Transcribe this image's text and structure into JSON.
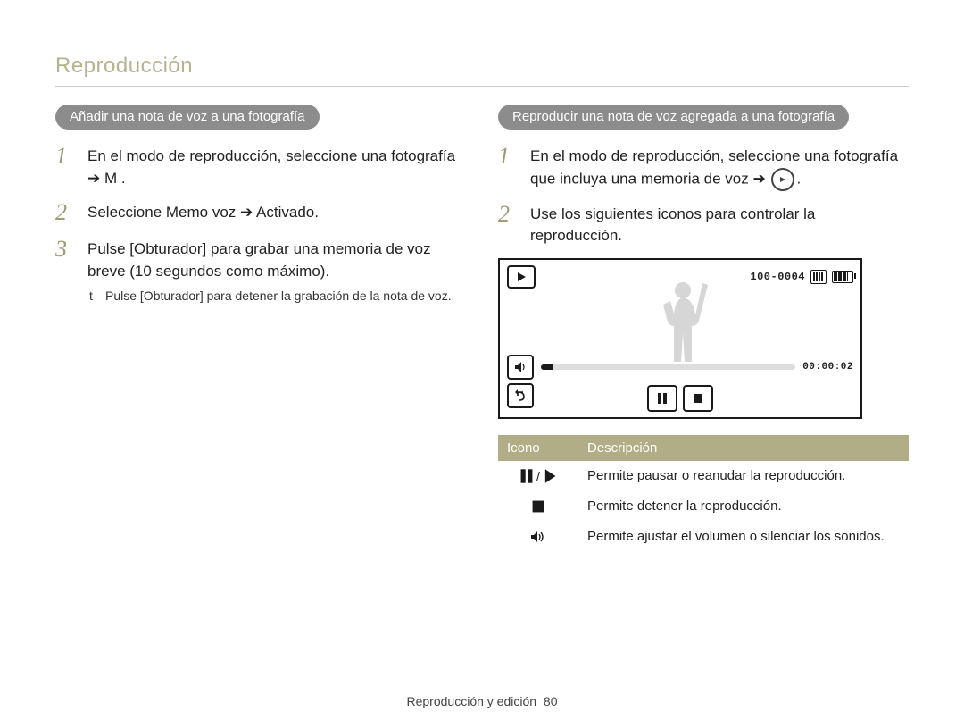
{
  "page_title": "Reproducción",
  "left": {
    "heading": "Añadir una nota de voz a una fotografía",
    "steps": [
      "En el modo de reproducción, seleccione una fotografía ➔ M .",
      "Seleccione Memo voz ➔ Activado.",
      "Pulse [Obturador] para grabar una memoria de voz breve (10 segundos como máximo)."
    ],
    "sub_bullet": "Pulse [Obturador] para detener la grabación de la nota de voz."
  },
  "right": {
    "heading": "Reproducir una nota de voz agregada a una fotografía",
    "step1_prefix": "En el modo de reproducción, seleccione una fotografía que incluya una memoria de voz ➔",
    "step1_suffix": ".",
    "step2": "Use los siguientes iconos para controlar la reproducción."
  },
  "camera": {
    "file_index": "100-0004",
    "timecode": "00:00:02"
  },
  "table": {
    "headers": [
      "Icono",
      "Descripción"
    ],
    "rows": [
      {
        "icon": "pause-play",
        "desc": "Permite pausar o reanudar la reproducción."
      },
      {
        "icon": "stop",
        "desc": "Permite detener la reproducción."
      },
      {
        "icon": "volume",
        "desc": "Permite ajustar el volumen o silenciar los sonidos."
      }
    ]
  },
  "footer": {
    "text": "Reproducción y edición",
    "page": "80"
  }
}
